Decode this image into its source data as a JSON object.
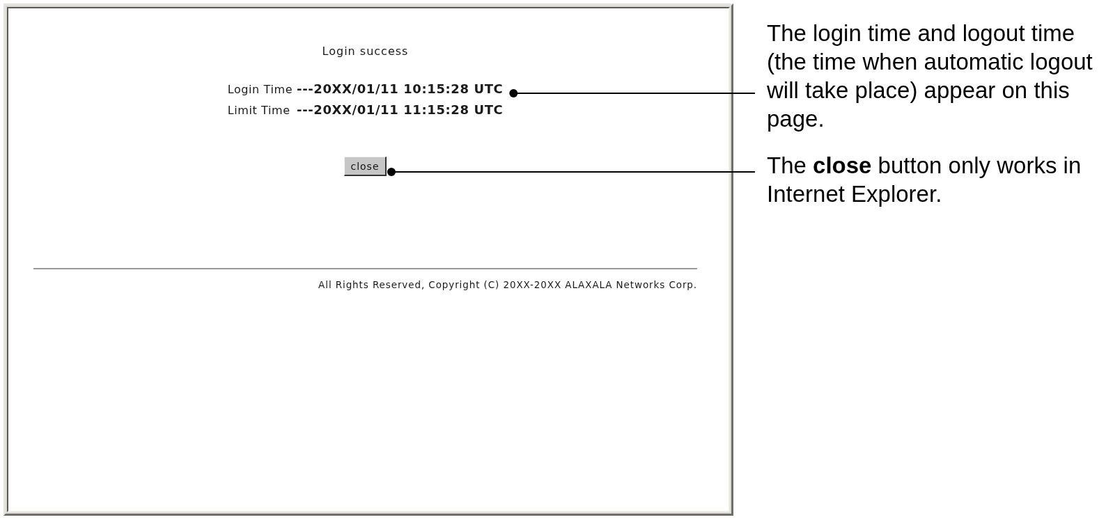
{
  "browser_page": {
    "heading": "Login success",
    "times": [
      {
        "label": "Login Time",
        "value": "---20XX/01/11 10:15:28 UTC"
      },
      {
        "label": "Limit Time",
        "value": "---20XX/01/11 11:15:28 UTC"
      }
    ],
    "close_button": "close",
    "footer": "All Rights Reserved, Copyright (C) 20XX-20XX ALAXALA Networks Corp."
  },
  "callouts": [
    "The login time and logout time (the time when automatic logout will take place) appear on this page.",
    "The **close** button only works in Internet Explorer."
  ]
}
